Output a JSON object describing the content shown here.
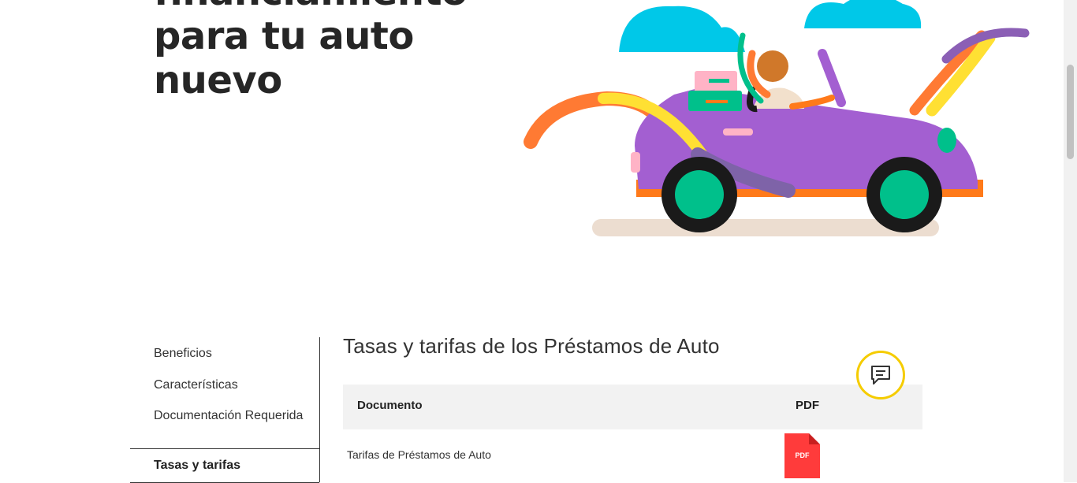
{
  "hero": {
    "title_line1": "financiamiento",
    "title_line2": "para tu auto",
    "title_line3": "nuevo"
  },
  "side_nav": {
    "items": [
      {
        "label": "Beneficios"
      },
      {
        "label": "Características"
      },
      {
        "label": "Documentación Requerida"
      },
      {
        "label": "Tasas y tarifas",
        "active": true
      }
    ]
  },
  "main": {
    "section_title": "Tasas y tarifas de los Préstamos de Auto",
    "table": {
      "headers": [
        "Documento",
        "PDF"
      ],
      "rows": [
        {
          "documento": "Tarifas de Préstamos de Auto",
          "pdf_label": "PDF"
        }
      ]
    }
  },
  "chat": {
    "icon": "chat-bubble-icon"
  },
  "colors": {
    "accent_yellow": "#f5cc00",
    "pdf_red": "#ff3b3b",
    "car_purple": "#a35fd1",
    "cloud_blue": "#00c8e8"
  }
}
